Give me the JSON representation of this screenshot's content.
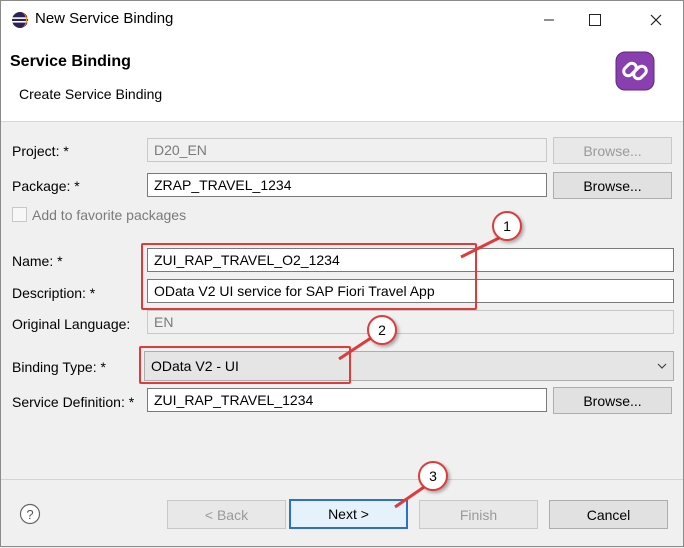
{
  "window": {
    "title": "New Service Binding",
    "minimize_icon": "minimize-icon",
    "maximize_icon": "maximize-icon",
    "close_icon": "close-icon"
  },
  "header": {
    "title": "Service Binding",
    "subtitle": "Create Service Binding",
    "icon": "service-binding-link-icon"
  },
  "form": {
    "project": {
      "label": "Project: *",
      "value": "D20_EN",
      "browse": "Browse..."
    },
    "package": {
      "label": "Package: *",
      "value": "ZRAP_TRAVEL_1234",
      "browse": "Browse..."
    },
    "favorite": {
      "label": "Add to favorite packages",
      "checked": false
    },
    "name": {
      "label": "Name: *",
      "value": "ZUI_RAP_TRAVEL_O2_1234"
    },
    "description": {
      "label": "Description: *",
      "value": "OData V2 UI service for SAP Fiori Travel App"
    },
    "language": {
      "label": "Original Language:",
      "value": "EN"
    },
    "binding_type": {
      "label": "Binding Type: *",
      "value": "OData V2 - UI"
    },
    "service_definition": {
      "label": "Service Definition: *",
      "value": "ZUI_RAP_TRAVEL_1234",
      "browse": "Browse..."
    }
  },
  "footer": {
    "help_icon": "help-icon",
    "back": "< Back",
    "next": "Next >",
    "finish": "Finish",
    "cancel": "Cancel"
  },
  "annotations": {
    "c1": "1",
    "c2": "2",
    "c3": "3",
    "color": "#e03a3a"
  }
}
